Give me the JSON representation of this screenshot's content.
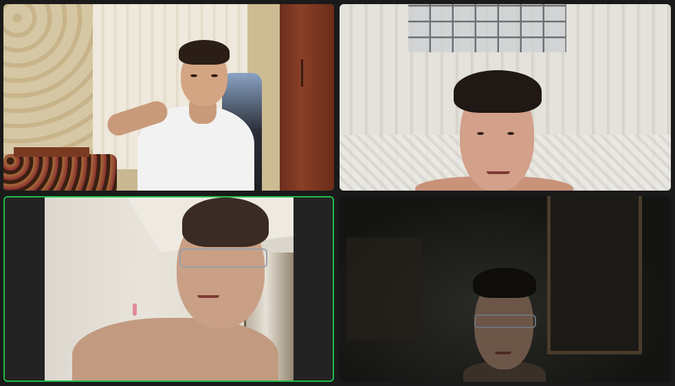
{
  "meeting": {
    "participants": [
      {
        "id": "p1",
        "active": false
      },
      {
        "id": "p2",
        "active": false
      },
      {
        "id": "p3",
        "active": true
      },
      {
        "id": "p4",
        "active": false
      }
    ]
  },
  "colors": {
    "background": "#1a1a1a",
    "active_speaker_border": "#1fbf4a"
  }
}
